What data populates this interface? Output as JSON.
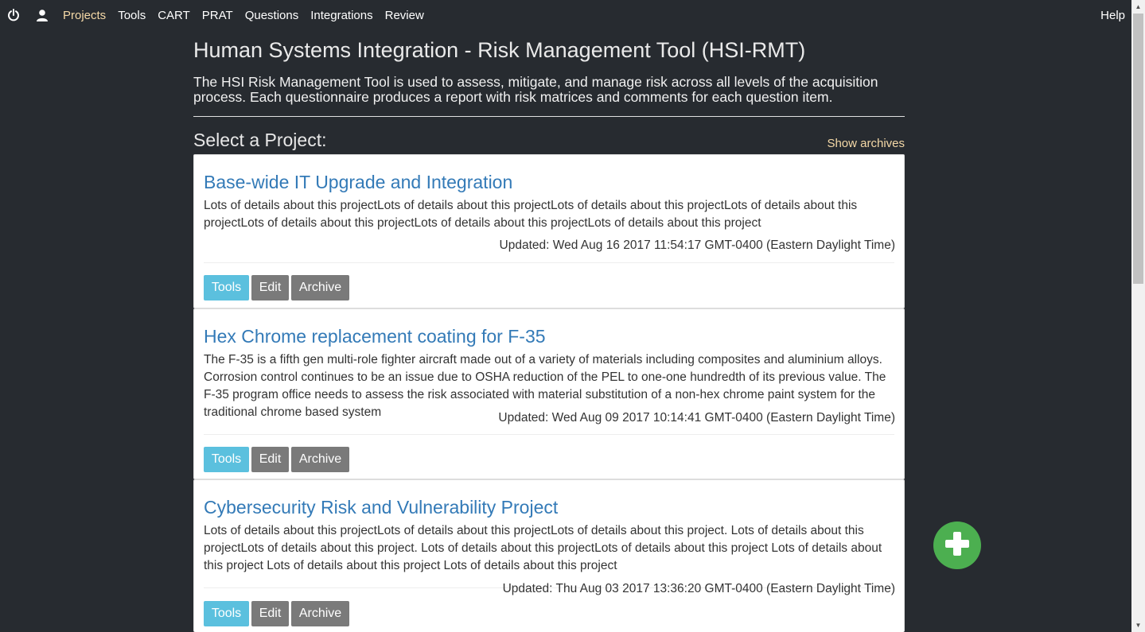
{
  "nav": {
    "power_icon": "power-icon",
    "user_icon": "user-icon",
    "links": [
      "Projects",
      "Tools",
      "CART",
      "PRAT",
      "Questions",
      "Integrations",
      "Review"
    ],
    "active": "Projects",
    "help": "Help"
  },
  "page": {
    "title": "Human Systems Integration - Risk Management Tool (HSI-RMT)",
    "intro": "The HSI Risk Management Tool is used to assess, mitigate, and manage risk across all levels of the acquisition process. Each questionnaire produces a report with risk matrices and comments for each question item.",
    "select_label": "Select a Project:",
    "show_archives": "Show archives"
  },
  "projects": [
    {
      "title": "Base-wide IT Upgrade and Integration",
      "description": "Lots of details about this projectLots of details about this projectLots of details about this projectLots of details about this projectLots of details about this projectLots of details about this projectLots of details about this project",
      "updated": "Updated: Wed Aug 16 2017 11:54:17 GMT-0400 (Eastern Daylight Time)",
      "buttons": {
        "tools": "Tools",
        "edit": "Edit",
        "archive": "Archive"
      }
    },
    {
      "title": "Hex Chrome replacement coating for F-35",
      "description": "The F-35 is a fifth gen multi-role fighter aircraft made out of a variety of materials including composites and aluminium alloys. Corrosion control continues to be an issue due to OSHA reduction of the PEL to one-one hundredth of its previous value. The F-35 program office needs to assess the risk associated with material substitution of a non-hex chrome paint system for the traditional chrome based system",
      "updated": "Updated: Wed Aug 09 2017 10:14:41 GMT-0400 (Eastern Daylight Time)",
      "buttons": {
        "tools": "Tools",
        "edit": "Edit",
        "archive": "Archive"
      }
    },
    {
      "title": "Cybersecurity Risk and Vulnerability Project",
      "description": "Lots of details about this projectLots of details about this projectLots of details about this project. Lots of details about this projectLots of details about this project. Lots of details about this projectLots of details about this project Lots of details about this project Lots of details about this project Lots of details about this project",
      "updated": "Updated: Thu Aug 03 2017 13:36:20 GMT-0400 (Eastern Daylight Time)",
      "buttons": {
        "tools": "Tools",
        "edit": "Edit",
        "archive": "Archive"
      }
    }
  ],
  "fab_icon": "plus-icon",
  "colors": {
    "background": "#272b30",
    "accent": "#f5d9a7",
    "link": "#337ab7",
    "tools_button": "#5bc0de",
    "secondary_button": "#7a7a7a",
    "fab": "#4caf50"
  }
}
